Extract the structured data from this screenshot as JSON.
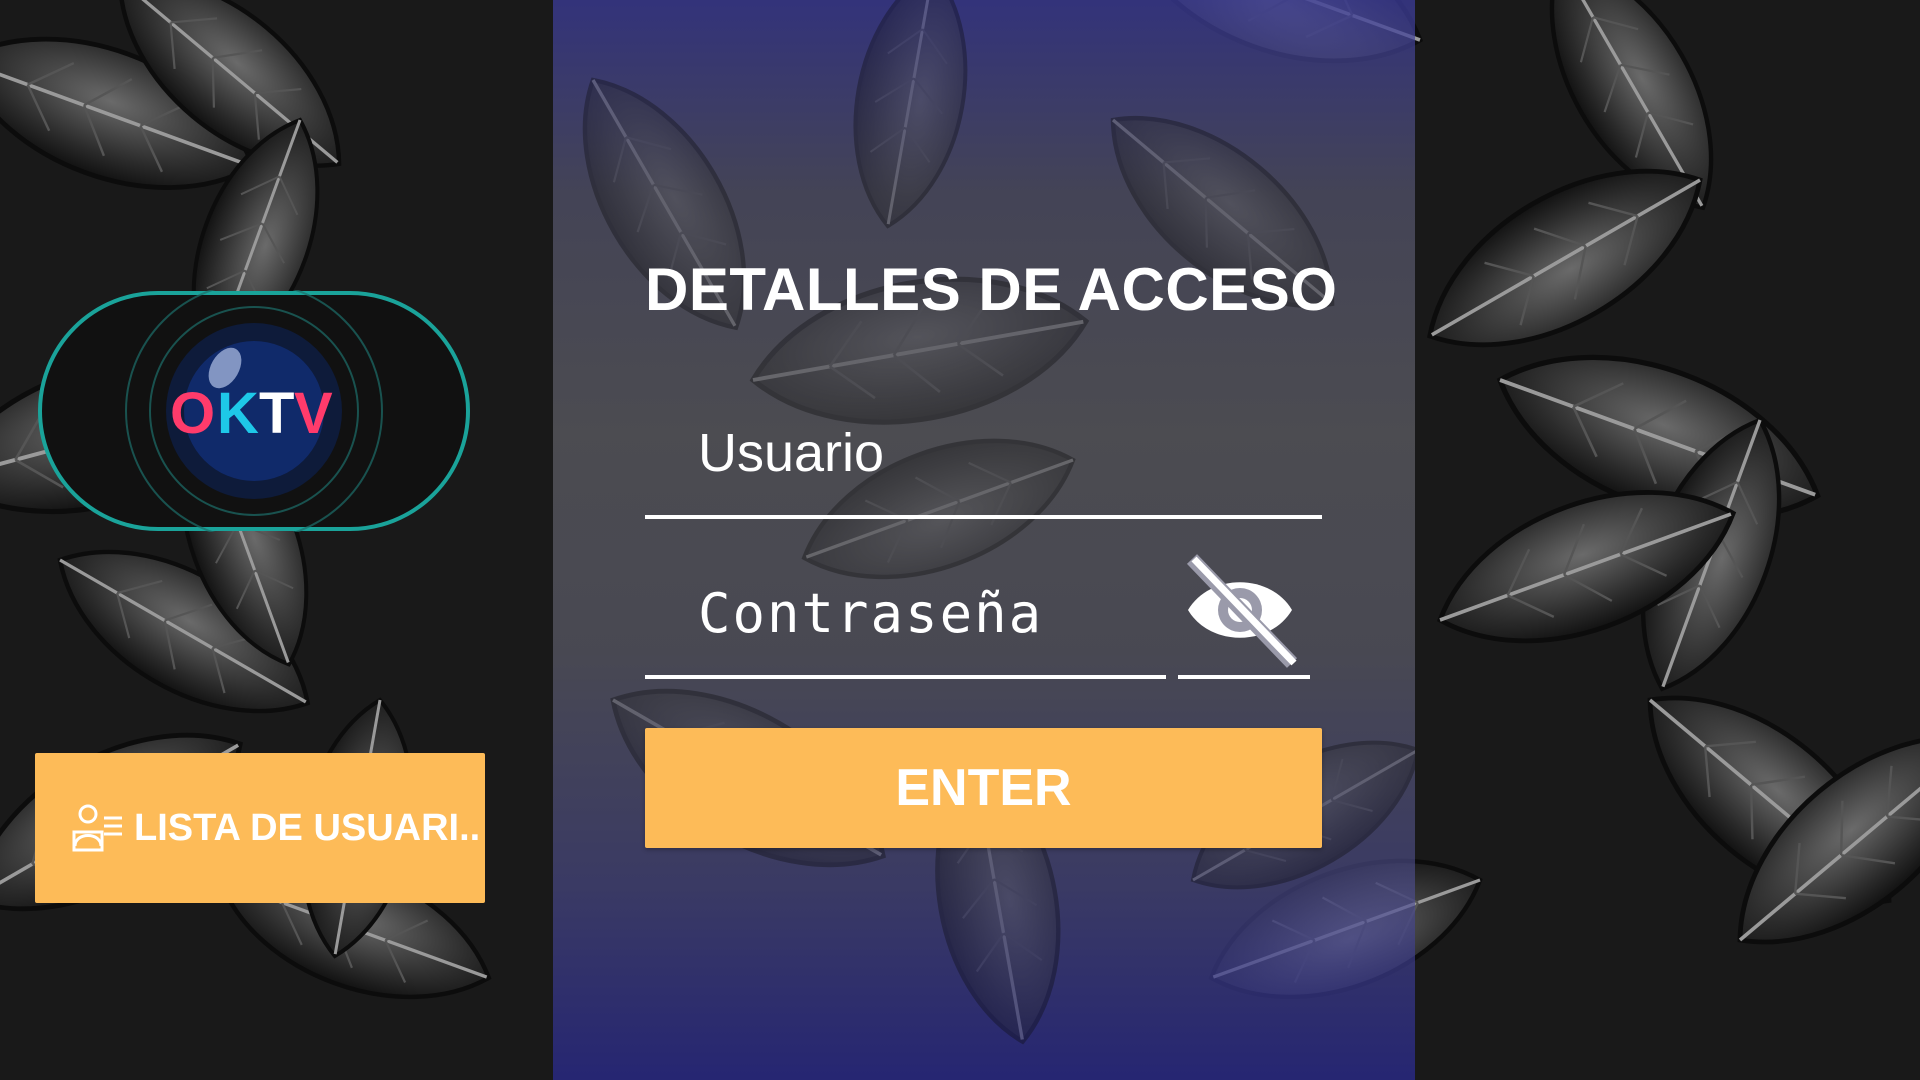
{
  "login": {
    "title": "DETALLES DE ACCESO",
    "username_placeholder": "Usuario",
    "password_placeholder": "Contraseña",
    "enter_label": "ENTER"
  },
  "logo": {
    "letters": [
      "O",
      "K",
      "T",
      "V"
    ],
    "letter_colors": [
      "#ff3b6b",
      "#1ec8e8",
      "#ffffff",
      "#ff3b6b"
    ]
  },
  "sidebar": {
    "user_list_label": "LISTA DE USUARI.."
  },
  "icons": {
    "password_toggle": "eye-slash-icon",
    "user_list": "user-list-icon"
  },
  "colors": {
    "accent": "#fdbb58",
    "panel_top": "#3a3a96",
    "text": "#ffffff",
    "logo_ring": "#1aa39a"
  }
}
